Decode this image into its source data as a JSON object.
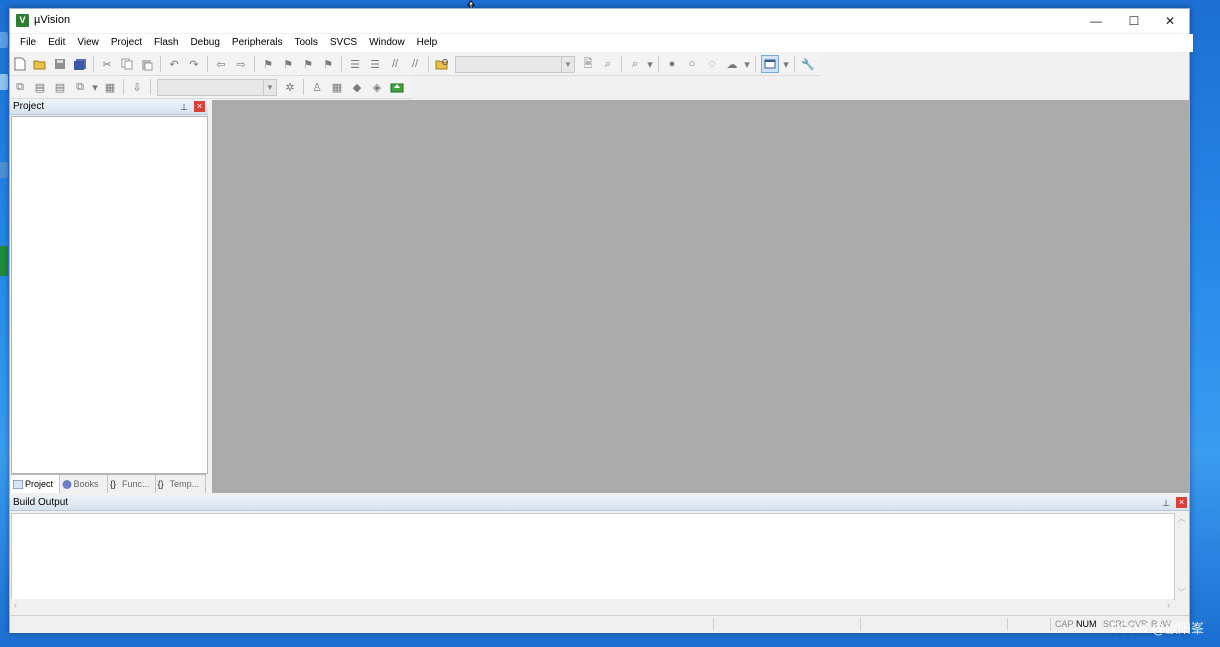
{
  "window": {
    "title": "µVision",
    "controls": {
      "minimize": "—",
      "maximize": "☐",
      "close": "✕"
    }
  },
  "menu": [
    "File",
    "Edit",
    "View",
    "Project",
    "Flash",
    "Debug",
    "Peripherals",
    "Tools",
    "SVCS",
    "Window",
    "Help"
  ],
  "project_panel": {
    "title": "Project",
    "tabs": [
      {
        "label": "Project",
        "active": true
      },
      {
        "label": "Books",
        "active": false
      },
      {
        "label": "Func...",
        "active": false
      },
      {
        "label": "Temp...",
        "active": false
      }
    ]
  },
  "build_output": {
    "title": "Build Output"
  },
  "status_flags": [
    {
      "label": "CAP",
      "on": false
    },
    {
      "label": "NUM",
      "on": true
    },
    {
      "label": "SCRL",
      "on": false
    },
    {
      "label": "OVR",
      "on": false
    },
    {
      "label": "R /W",
      "on": false
    }
  ],
  "watermark": "CSDN @欧阳峯",
  "icons": {
    "app": "uvision-logo-icon",
    "pin": "pin-icon",
    "close": "close-icon"
  },
  "colors": {
    "editor_bg": "#ababab",
    "panel_close": "#d9423b",
    "desktop": "#2585e6"
  }
}
